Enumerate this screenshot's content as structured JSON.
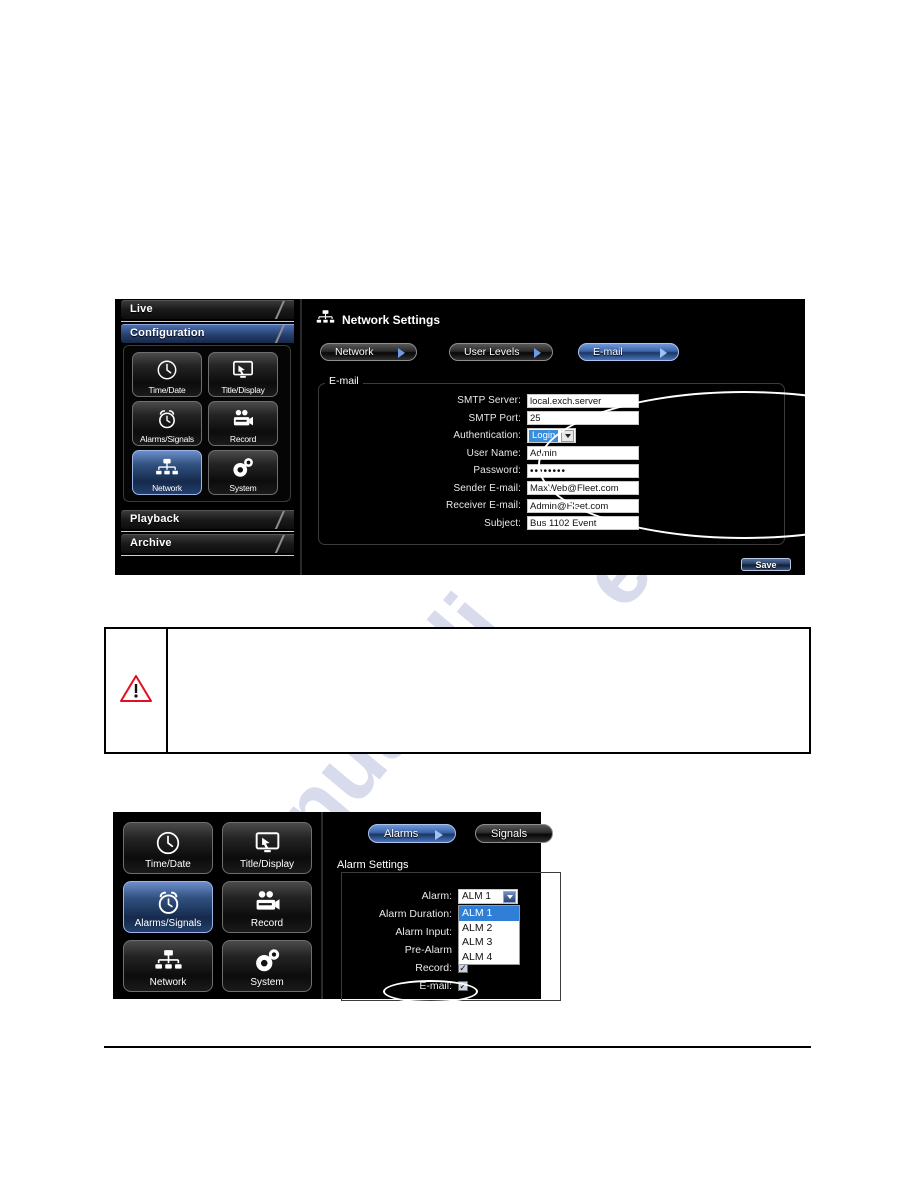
{
  "watermark": {
    "line1": "manualsli",
    "line2": "e.Com"
  },
  "dvr_network": {
    "sidebar": {
      "tabs": [
        {
          "label": "Live",
          "active": false
        },
        {
          "label": "Configuration",
          "active": true
        },
        {
          "label": "Playback",
          "active": false
        },
        {
          "label": "Archive",
          "active": false
        }
      ],
      "icons": [
        {
          "label": "Time/Date",
          "icon": "clock-icon",
          "selected": false
        },
        {
          "label": "Title/Display",
          "icon": "monitor-cursor-icon",
          "selected": false
        },
        {
          "label": "Alarms/Signals",
          "icon": "alarm-clock-icon",
          "selected": false
        },
        {
          "label": "Record",
          "icon": "camcorder-icon",
          "selected": false
        },
        {
          "label": "Network",
          "icon": "network-tree-icon",
          "selected": true
        },
        {
          "label": "System",
          "icon": "gears-icon",
          "selected": false
        }
      ]
    },
    "header": {
      "title": "Network Settings",
      "icon": "network-tree-icon"
    },
    "tabs": [
      {
        "label": "Network",
        "active": false
      },
      {
        "label": "User Levels",
        "active": false
      },
      {
        "label": "E-mail",
        "active": true
      }
    ],
    "group": {
      "legend": "E-mail"
    },
    "fields": [
      {
        "label": "SMTP Server:",
        "value": "local.exch.server",
        "type": "text"
      },
      {
        "label": "SMTP Port:",
        "value": "25",
        "type": "text"
      },
      {
        "label": "Authentication:",
        "value": "Login",
        "type": "select"
      },
      {
        "label": "User Name:",
        "value": "Admin",
        "type": "text"
      },
      {
        "label": "Password:",
        "value": "••••••••",
        "type": "password"
      },
      {
        "label": "Sender E-mail:",
        "value": "MaxWeb@Fleet.com",
        "type": "text"
      },
      {
        "label": "Receiver E-mail:",
        "value": "Admin@Fleet.com",
        "type": "text"
      },
      {
        "label": "Subject:",
        "value": "Bus 1102 Event",
        "type": "text"
      }
    ],
    "save_label": "Save",
    "highlight_color": "#ffffff"
  },
  "warning_box": {
    "icon": "warning-triangle-icon",
    "text": ""
  },
  "dvr_alarm": {
    "icons": [
      {
        "label": "Time/Date",
        "icon": "clock-icon",
        "selected": false
      },
      {
        "label": "Title/Display",
        "icon": "monitor-cursor-icon",
        "selected": false
      },
      {
        "label": "Alarms/Signals",
        "icon": "alarm-clock-icon",
        "selected": true
      },
      {
        "label": "Record",
        "icon": "camcorder-icon",
        "selected": false
      },
      {
        "label": "Network",
        "icon": "network-tree-icon",
        "selected": false
      },
      {
        "label": "System",
        "icon": "gears-icon",
        "selected": false
      }
    ],
    "tabs": [
      {
        "label": "Alarms",
        "active": true
      },
      {
        "label": "Signals",
        "active": false
      }
    ],
    "group": {
      "legend": "Alarm Settings"
    },
    "fields": [
      {
        "label": "Alarm:",
        "value": "ALM 1",
        "type": "select"
      },
      {
        "label": "Alarm Duration:",
        "value": "",
        "type": "hidden"
      },
      {
        "label": "Alarm Input:",
        "value": "",
        "type": "hidden"
      },
      {
        "label": "Pre-Alarm",
        "value": "",
        "type": "hidden"
      },
      {
        "label": "Record:",
        "value": "checked",
        "type": "checkbox"
      },
      {
        "label": "E-mail:",
        "value": "checked",
        "type": "checkbox"
      }
    ],
    "dropdown_options": [
      {
        "label": "ALM 1",
        "highlighted": true
      },
      {
        "label": "ALM 2",
        "highlighted": false
      },
      {
        "label": "ALM 3",
        "highlighted": false
      },
      {
        "label": "ALM 4",
        "highlighted": false
      }
    ],
    "checkbox_mark": "✓"
  }
}
